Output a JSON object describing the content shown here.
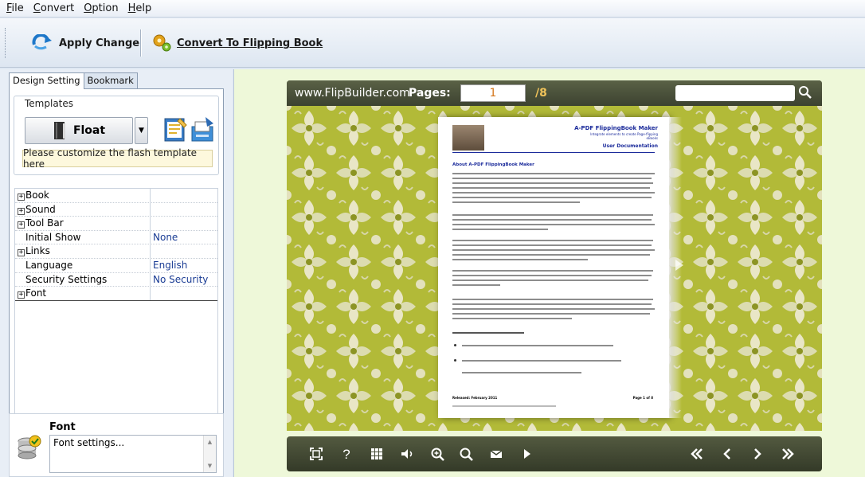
{
  "menu": {
    "items": [
      "File",
      "Convert",
      "Option",
      "Help"
    ]
  },
  "toolbar": {
    "apply_label": "Apply Change",
    "convert_label": "Convert To Flipping Book"
  },
  "left": {
    "tabs": [
      "Design Setting",
      "Bookmark"
    ],
    "templates_legend": "Templates",
    "template_name": "Float",
    "customize_hint": "Please customize the flash template here",
    "properties": [
      {
        "key": "Book",
        "value": ""
      },
      {
        "key": "Sound",
        "value": ""
      },
      {
        "key": "Tool Bar",
        "value": ""
      },
      {
        "key": "Initial Show",
        "value": "None"
      },
      {
        "key": "Links",
        "value": ""
      },
      {
        "key": "Language",
        "value": "English"
      },
      {
        "key": "Security Settings",
        "value": "No Security"
      },
      {
        "key": "Font",
        "value": ""
      }
    ],
    "font_panel": {
      "title": "Font",
      "description": "Font settings..."
    }
  },
  "viewer": {
    "site": "www.FlipBuilder.com",
    "pages_label": "Pages:",
    "current_page": "1",
    "total_pages": "/8",
    "search_placeholder": ""
  },
  "document": {
    "title": "A-PDF FlippingBook Maker",
    "subtitle": "Integrate elements to create Page-flipping eBooks",
    "user_doc": "User Documentation",
    "heading": "About A-PDF FlippingBook Maker",
    "footer_left": "Released: February 2011",
    "footer_right": "Page 1 of 8"
  },
  "colors": {
    "accent_blue": "#1b2b9b",
    "viewer_bg": "#2e3424",
    "pattern_green": "#b4bc3a",
    "panel_green": "#eef8d9"
  },
  "icons": {
    "apply": "refresh-icon",
    "convert": "gears-icon",
    "float_template": "book-icon",
    "edit_template": "edit-doc-icon",
    "export_template": "export-icon",
    "font_panel": "settings-db-icon",
    "controls": [
      "fit-screen-icon",
      "help-icon",
      "thumbnails-icon",
      "sound-icon",
      "zoom-in-icon",
      "search-icon",
      "email-icon",
      "play-icon",
      "first-page-icon",
      "prev-page-icon",
      "next-page-icon",
      "last-page-icon"
    ]
  }
}
